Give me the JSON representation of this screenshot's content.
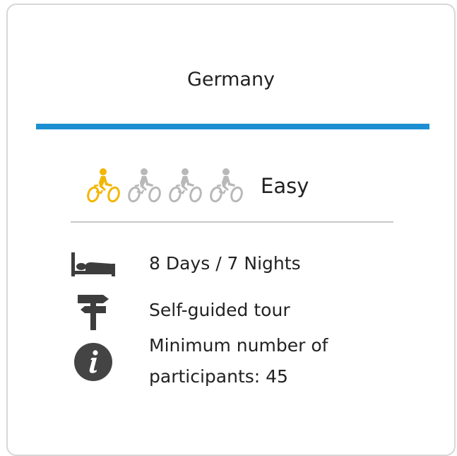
{
  "card": {
    "title": "Germany",
    "accent_color": "#1b8fd1"
  },
  "difficulty": {
    "level": 1,
    "max_level": 4,
    "label": "Easy",
    "active_color": "#f2b705",
    "inactive_color": "#b8b8b8",
    "icon": "cyclist-icon"
  },
  "details": [
    {
      "icon": "bed-icon",
      "text": "8 Days / 7 Nights"
    },
    {
      "icon": "signpost-icon",
      "text": "Self-guided tour"
    },
    {
      "icon": "info-icon",
      "text_line1": "Minimum number of",
      "text_line2": "participants: 45"
    }
  ]
}
